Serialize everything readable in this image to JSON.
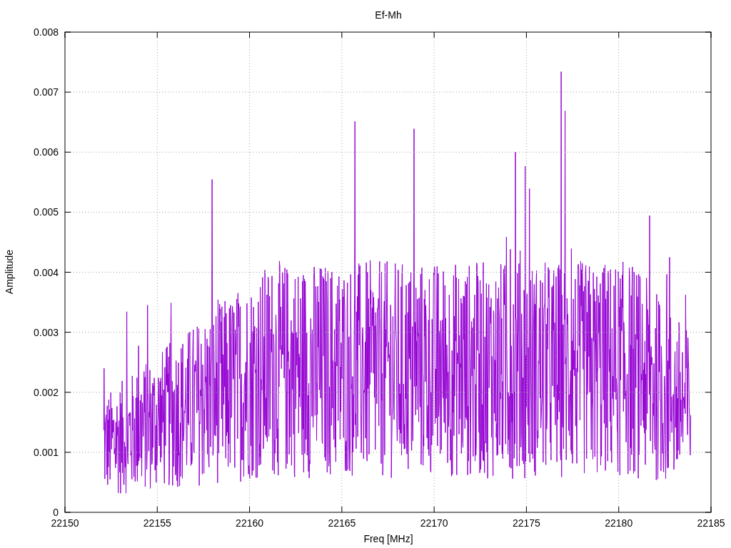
{
  "chart": {
    "chart_data": {
      "type": "line",
      "title": "Ef-Mh",
      "xlabel": "Freq [MHz]",
      "ylabel": "Amplitude",
      "xlim": [
        22150,
        22185
      ],
      "ylim": [
        0,
        0.008
      ],
      "grid": true,
      "xticks": [
        22150,
        22155,
        22160,
        22165,
        22170,
        22175,
        22180,
        22185
      ],
      "yticks": [
        {
          "value": 0,
          "label": "0"
        },
        {
          "value": 0.001,
          "label": "0.001"
        },
        {
          "value": 0.002,
          "label": "0.002"
        },
        {
          "value": 0.003,
          "label": "0.003"
        },
        {
          "value": 0.004,
          "label": "0.004"
        },
        {
          "value": 0.005,
          "label": "0.005"
        },
        {
          "value": 0.006,
          "label": "0.006"
        },
        {
          "value": 0.007,
          "label": "0.007"
        },
        {
          "value": 0.008,
          "label": "0.008"
        }
      ]
    }
  }
}
